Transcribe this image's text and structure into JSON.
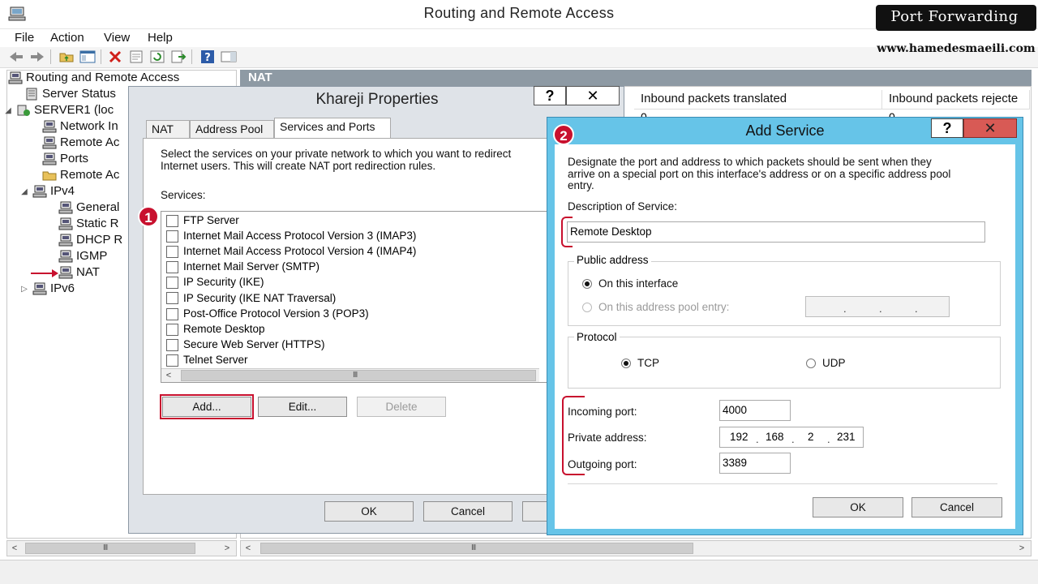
{
  "window": {
    "title": "Routing and Remote Access"
  },
  "menu": [
    "File",
    "Action",
    "View",
    "Help"
  ],
  "tree": {
    "items": [
      {
        "label": "Routing and Remote Access",
        "icon": "computer-icon",
        "expander": ""
      },
      {
        "label": "Server Status",
        "icon": "server-status-icon",
        "expander": ""
      },
      {
        "label": "SERVER1 (loc",
        "icon": "server-icon",
        "expander": "◢"
      },
      {
        "label": "Network In",
        "icon": "network-icon",
        "expander": ""
      },
      {
        "label": "Remote Ac",
        "icon": "network-icon",
        "expander": ""
      },
      {
        "label": "Ports",
        "icon": "network-icon",
        "expander": ""
      },
      {
        "label": "Remote Ac",
        "icon": "folder-icon",
        "expander": ""
      },
      {
        "label": "IPv4",
        "icon": "network-icon",
        "expander": "◢"
      },
      {
        "label": "General",
        "icon": "network-icon",
        "expander": ""
      },
      {
        "label": "Static R",
        "icon": "network-icon",
        "expander": ""
      },
      {
        "label": "DHCP R",
        "icon": "network-icon",
        "expander": ""
      },
      {
        "label": "IGMP",
        "icon": "network-icon",
        "expander": ""
      },
      {
        "label": "NAT",
        "icon": "network-icon",
        "expander": ""
      },
      {
        "label": "IPv6",
        "icon": "network-icon",
        "expander": "▷"
      }
    ]
  },
  "right": {
    "header": "NAT",
    "columns": [
      "Inbound packets translated",
      "Inbound packets rejecte"
    ],
    "values": [
      "0",
      "0"
    ]
  },
  "khareji": {
    "title": "Khareji Properties",
    "help": "?",
    "close": "✕",
    "tabs": [
      "NAT",
      "Address Pool",
      "Services and Ports"
    ],
    "description_line1": "Select the services on your private network to which you want to redirect",
    "description_line2": "Internet users. This will create NAT port redirection rules.",
    "services_label": "Services:",
    "services": [
      "FTP Server",
      "Internet Mail Access Protocol Version 3 (IMAP3)",
      "Internet Mail Access Protocol Version 4 (IMAP4)",
      "Internet Mail Server (SMTP)",
      "IP Security (IKE)",
      "IP Security (IKE NAT Traversal)",
      "Post-Office Protocol Version 3 (POP3)",
      "Remote Desktop",
      "Secure Web Server (HTTPS)",
      "Telnet Server"
    ],
    "add": "Add...",
    "edit": "Edit...",
    "delete": "Delete",
    "ok": "OK",
    "cancel": "Cancel"
  },
  "add_service": {
    "title": "Add Service",
    "help": "?",
    "close": "✕",
    "intro_line1": "Designate the port and address to which packets should be sent when they",
    "intro_line2": "arrive on a special port on this interface's address or on a specific address pool",
    "intro_line3": "entry.",
    "description_label": "Description of Service:",
    "description_value": "Remote Desktop",
    "public_address_label": "Public address",
    "on_interface": "On this interface",
    "on_pool": "On this address pool entry:",
    "pool_ip_dots": [
      ".",
      ".",
      "."
    ],
    "protocol_label": "Protocol",
    "tcp": "TCP",
    "udp": "UDP",
    "incoming_port_label": "Incoming port:",
    "incoming_port": "4000",
    "private_address_label": "Private address:",
    "private_address": [
      "192",
      "168",
      "2",
      "231"
    ],
    "outgoing_port_label": "Outgoing port:",
    "outgoing_port": "3389",
    "ok": "OK",
    "cancel": "Cancel"
  },
  "annotations": {
    "badge1": "1",
    "badge2": "2"
  },
  "branding": {
    "title": "Port Forwarding",
    "site": "www.hamedesmaeili.com"
  },
  "scroll": {
    "left_arrow": "<",
    "right_arrow": ">",
    "grip": "III"
  },
  "colors": {
    "accent_red": "#c8102e",
    "dialog_frame": "#66c4e8",
    "header_gray": "#8e9aa4"
  }
}
